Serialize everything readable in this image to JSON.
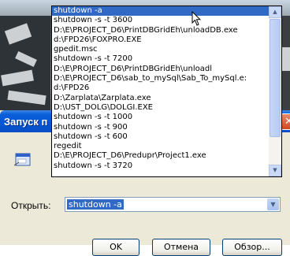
{
  "dialog": {
    "title": "Запуск п",
    "open_label": "Открыть:",
    "combo_value": "shutdown -a",
    "buttons": {
      "ok": "OK",
      "cancel": "Отмена",
      "browse": "Обзор..."
    }
  },
  "dropdown": {
    "items": [
      "shutdown -a",
      "shutdown -s -t 3600",
      "D:\\E\\PROJECT_D6\\PrintDBGridEh\\unloadDB.exe",
      "d:\\FPD26\\FOXPRO.EXE",
      "gpedit.msc",
      "shutdown -s -t 7200",
      "D:\\E\\PROJECT_D6\\PrintDBGridEh\\unloadl",
      "D:\\E\\PROJECT_D6\\sab_to_mySql\\Sab_To_mySql.e:",
      "d:\\FPD26",
      "D:\\Zarplata\\Zarplata.exe",
      "D:\\UST_DOLG\\DOLGI.EXE",
      "shutdown -s -t 1000",
      "shutdown -s -t 900",
      "shutdown -s -t 600",
      "regedit",
      "D:\\E\\PROJECT_D6\\Predupr\\Project1.exe",
      "shutdown -s -t 3720"
    ],
    "selected_index": 0
  },
  "icons": {
    "close": "close-icon",
    "run": "run-icon",
    "arrow": "chevron-down-icon",
    "cursor": "mouse-cursor-icon"
  },
  "colors": {
    "titlebar": "#0656d6",
    "selection": "#316ac5",
    "dialog_bg": "#ece9d8"
  }
}
